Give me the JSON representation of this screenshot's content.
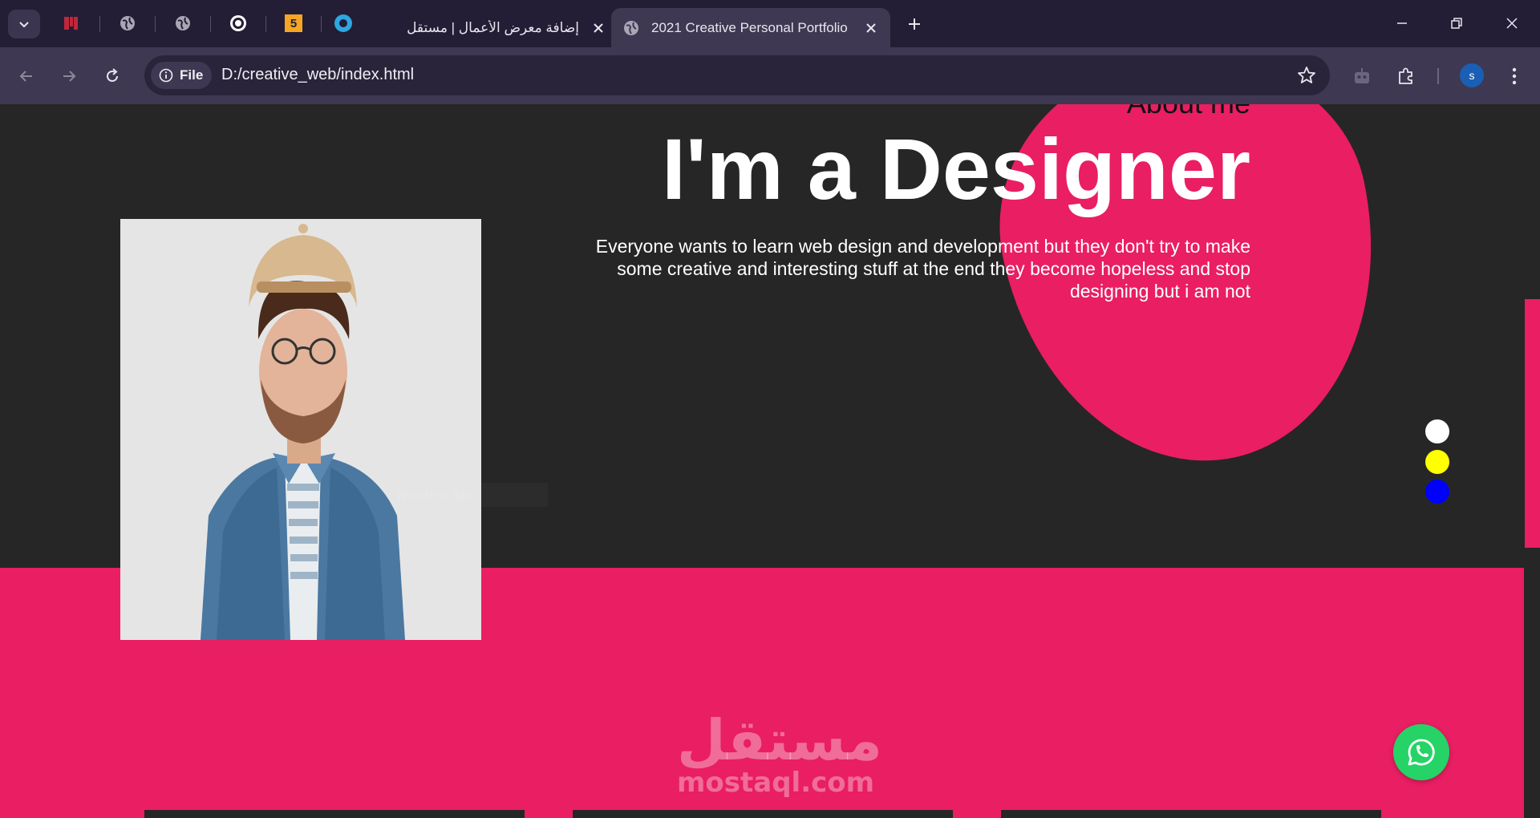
{
  "browser": {
    "tabs": [
      {
        "label": "إضافة معرض الأعمال | مستقل",
        "active": false
      },
      {
        "label": "2021 Creative Personal Portfolio",
        "active": true
      }
    ],
    "pinned_tabs": [
      "tm-favicon-icon",
      "globe-icon",
      "globe-icon",
      "target-favicon-icon",
      "five-favicon-icon",
      "circle-favicon-icon"
    ],
    "pinned_five_text": "5",
    "address": {
      "scheme_label": "File",
      "url": "D:/creative_web/index.html"
    },
    "profile_initial": "s"
  },
  "page": {
    "about_label": "About me",
    "headline": "I'm a Designer",
    "intro": "Everyone wants to learn web design and development but they don't try to make some creative and interesting stuff at the end they become hopeless and stop designing but i am not",
    "ghost_text": "Window Shi",
    "color_options": [
      "#ffffff",
      "#ffff00",
      "#0000ff"
    ],
    "watermark": {
      "arabic": "مستقل",
      "latin": "mostaql.com"
    },
    "colors": {
      "accent": "#e91e63",
      "background": "#262626",
      "whatsapp": "#25d366"
    }
  }
}
